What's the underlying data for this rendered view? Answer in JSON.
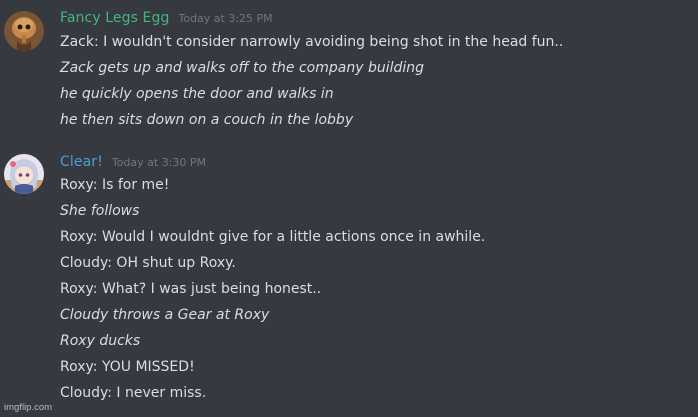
{
  "messages": [
    {
      "username": "Fancy Legs Egg",
      "username_color": "#43b581",
      "timestamp": "Today at 3:25 PM",
      "lines": [
        {
          "text": "Zack: I wouldn't consider narrowly avoiding being shot in the head fun..",
          "italic": false
        },
        {
          "text": "Zack gets up and walks off to the company building",
          "italic": true
        },
        {
          "text": "he quickly opens the door and walks in",
          "italic": true
        },
        {
          "text": "he then sits down on a couch in the lobby",
          "italic": true
        }
      ]
    },
    {
      "username": "Clear!",
      "username_color": "#4a9fd8",
      "timestamp": "Today at 3:30 PM",
      "lines": [
        {
          "text": "Roxy: Is for me!",
          "italic": false
        },
        {
          "text": "She follows",
          "italic": true
        },
        {
          "text": "Roxy: Would I wouldnt give for a little actions once in awhile.",
          "italic": false
        },
        {
          "text": "Cloudy: OH shut up Roxy.",
          "italic": false
        },
        {
          "text": "Roxy: What? I was just being honest..",
          "italic": false
        },
        {
          "text": "Cloudy throws a Gear at Roxy",
          "italic": true
        },
        {
          "text": "Roxy ducks",
          "italic": true
        },
        {
          "text": "Roxy: YOU MISSED!",
          "italic": false
        },
        {
          "text": "Cloudy: I never miss.",
          "italic": false
        }
      ]
    }
  ],
  "watermark": "imgflip.com"
}
